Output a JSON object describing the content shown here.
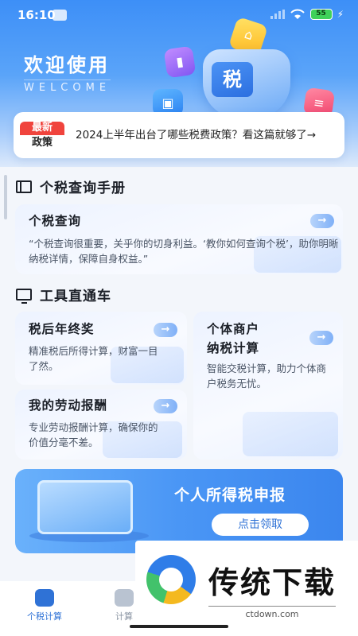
{
  "status_bar": {
    "time": "16:10",
    "battery": "55"
  },
  "header": {
    "welcome_title": "欢迎使用",
    "welcome_sub": "WELCOME",
    "tax_badge": "税"
  },
  "news": {
    "badge_top": "最新",
    "badge_bottom": "政策",
    "text": "2024上半年出台了哪些税费政策？看这篇就够了→"
  },
  "handbook": {
    "title": "个税查询手册",
    "card": {
      "title": "个税查询",
      "desc": "“个税查询很重要，关乎你的切身利益。‘教你如何查询个税’，助你明晰纳税详情，保障自身权益。”",
      "arrow": "→"
    }
  },
  "tools": {
    "title": "工具直通车",
    "annual_bonus": {
      "title": "税后年终奖",
      "desc": "精准税后所得计算，财富一目了然。",
      "arrow": "→"
    },
    "business": {
      "title_line1": "个体商户",
      "title_line2": "纳税计算",
      "desc": "智能交税计算，助力个体商户税务无忧。",
      "arrow": "→"
    },
    "labor": {
      "title": "我的劳动报酬",
      "desc": "专业劳动报酬计算，确保你的价值分毫不差。",
      "arrow": "→"
    }
  },
  "banner": {
    "title": "个人所得税申报",
    "button": "点击领取"
  },
  "bottom_nav": {
    "items": [
      {
        "label": "个税计算",
        "active": true
      },
      {
        "label": "计算",
        "active": false
      }
    ]
  },
  "watermark": {
    "brand": "传统下载",
    "url": "ctdown.com"
  },
  "colors": {
    "primary": "#3d8ff7",
    "badge_red": "#f0443d",
    "active_nav": "#2f72d6"
  }
}
